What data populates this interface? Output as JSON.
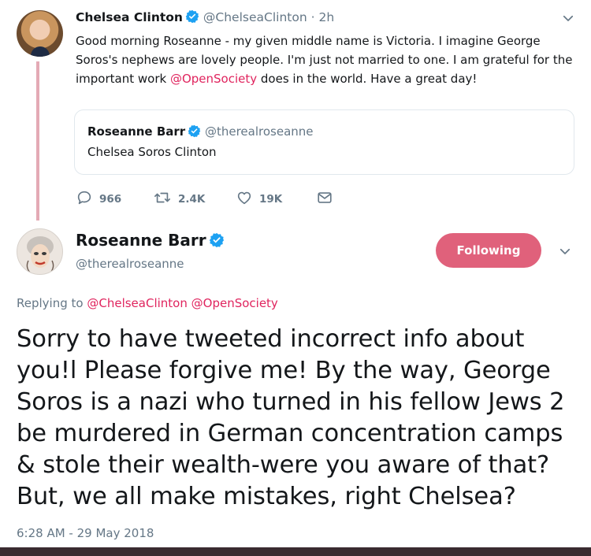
{
  "parent_tweet": {
    "author_name": "Chelsea Clinton",
    "author_handle": "@ChelseaClinton",
    "separator": "·",
    "time": "2h",
    "text_parts": [
      "Good morning Roseanne - my given middle name is Victoria. I imagine George Soros's nephews are lovely people. I'm just not married to one. I am grateful for the important work ",
      "@OpenSociety",
      " does in the world. Have a great day!"
    ],
    "quoted": {
      "author_name": "Roseanne Barr",
      "author_handle": "@therealroseanne",
      "text": "Chelsea Soros Clinton"
    },
    "actions": {
      "replies": "966",
      "retweets": "2.4K",
      "likes": "19K"
    }
  },
  "main_tweet": {
    "author_name": "Roseanne Barr",
    "author_handle": "@therealroseanne",
    "follow_button": "Following",
    "replying_label": "Replying to",
    "replying_to": [
      "@ChelseaClinton",
      "@OpenSociety"
    ],
    "text": "Sorry to have tweeted incorrect info about you!l Please forgive me! By the way, George Soros is a nazi who turned in his fellow Jews 2 be murdered in German concentration camps & stole their wealth-were you aware of that? But, we all make mistakes, right Chelsea?",
    "timestamp": "6:28 AM - 29 May 2018"
  },
  "colors": {
    "link": "#e0245e",
    "follow_button": "#e0617b",
    "thread_line": "#e4aab5",
    "verified": "#1da1f2",
    "muted": "#657786"
  }
}
